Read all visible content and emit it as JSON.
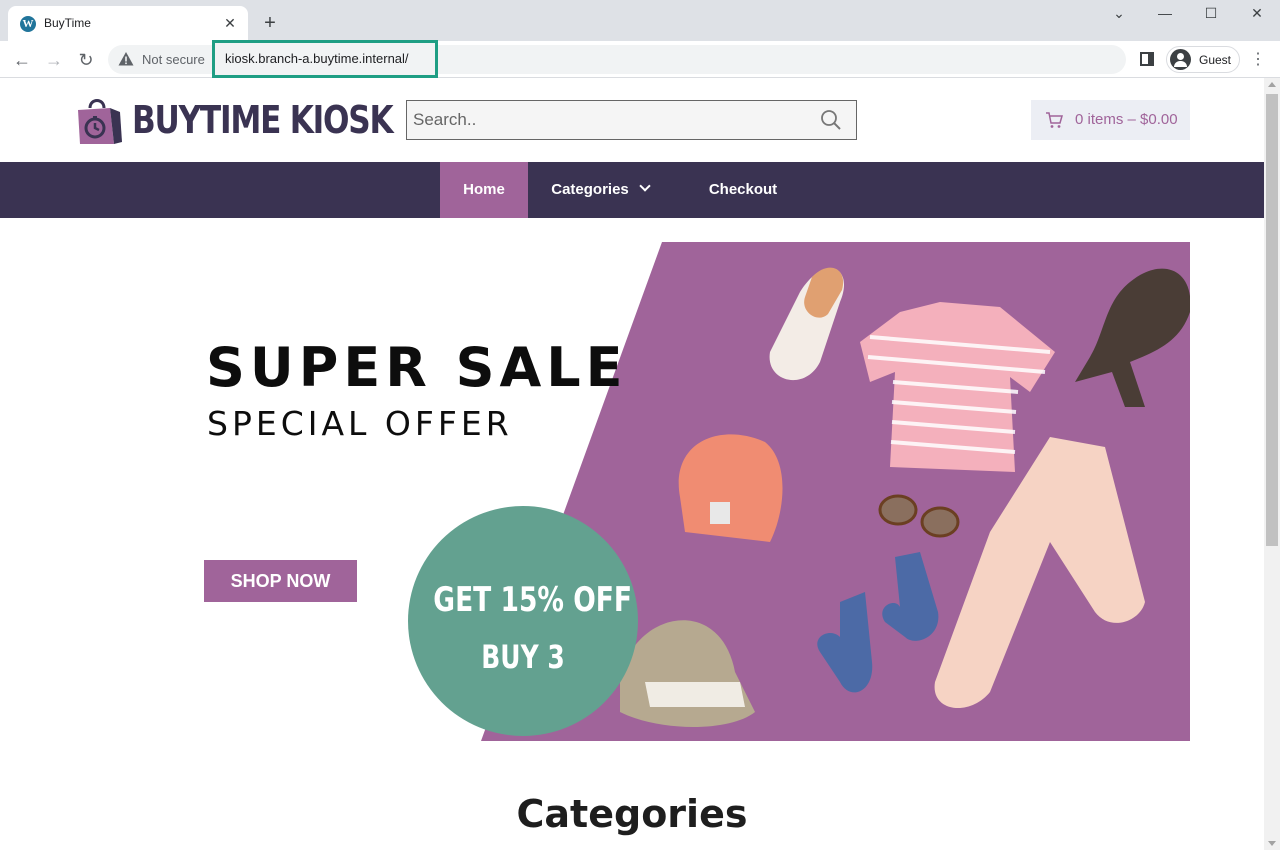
{
  "browser": {
    "tab_title": "BuyTime",
    "tab_favicon": "wordpress-icon",
    "security_label": "Not secure",
    "url": "kiosk.branch-a.buytime.internal/",
    "profile_label": "Guest"
  },
  "site": {
    "logo_text": "BUYTIME KIOSK",
    "search_placeholder": "Search..",
    "cart_label": "0 items – $0.00"
  },
  "nav": {
    "home": "Home",
    "categories": "Categories",
    "checkout": "Checkout"
  },
  "hero": {
    "title": "SUPER SALE",
    "subtitle": "SPECIAL OFFER",
    "button": "SHOP NOW",
    "promo_line1": "GET 15% OFF",
    "promo_line2": "BUY 3"
  },
  "sections": {
    "categories_heading": "Categories"
  },
  "colors": {
    "brand_dark": "#3a3352",
    "brand_purple": "#a0649a",
    "promo_green": "#63a190",
    "url_highlight": "#1f9e84"
  }
}
